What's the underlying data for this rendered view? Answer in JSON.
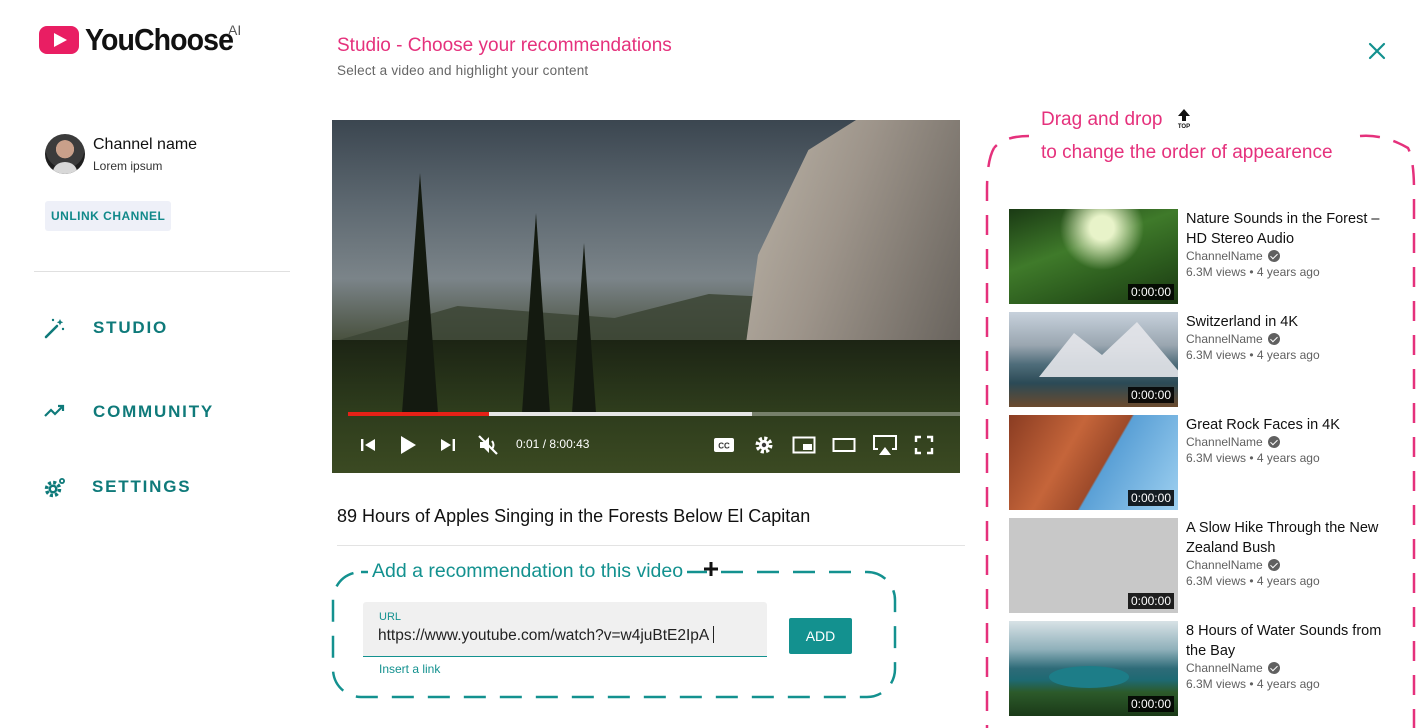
{
  "app": {
    "logo_text": "YouChoose",
    "logo_superscript": "AI"
  },
  "sidebar": {
    "channel_name": "Channel name",
    "channel_subtitle": "Lorem ipsum",
    "unlink_label": "UNLINK CHANNEL",
    "nav": [
      {
        "label": "STUDIO",
        "icon": "magic-wand-icon"
      },
      {
        "label": "COMMUNITY",
        "icon": "trending-icon"
      },
      {
        "label": "SETTINGS",
        "icon": "gear-icon"
      }
    ]
  },
  "header": {
    "title": "Studio - Choose your recommendations",
    "subtitle": "Select a video and highlight your content",
    "close_icon": "close-icon"
  },
  "player": {
    "current_time": "0:01",
    "separator": "/",
    "duration": "8:00:43",
    "played_fraction": 0.23,
    "buffered_fraction": 0.66
  },
  "video": {
    "title": "89 Hours of Apples Singing in the Forests Below El Capitan"
  },
  "add_recommendation": {
    "title": "Add a recommendation to this video",
    "url_label": "URL",
    "url_value": "https://www.youtube.com/watch?v=w4juBtE2IpA",
    "helper_text": "Insert a link",
    "add_label": "ADD"
  },
  "recommendations_panel": {
    "title": "Drag and drop",
    "subtitle": "to change the order of appearence",
    "items": [
      {
        "title": "Nature Sounds in the Forest – HD Stereo Audio",
        "channel": "ChannelName",
        "views": "6.3M views",
        "age": "4 years ago",
        "duration": "0:00:00"
      },
      {
        "title": "Switzerland in 4K",
        "channel": "ChannelName",
        "views": "6.3M views",
        "age": "4 years ago",
        "duration": "0:00:00"
      },
      {
        "title": "Great Rock Faces in 4K",
        "channel": "ChannelName",
        "views": "6.3M views",
        "age": "4 years ago",
        "duration": "0:00:00"
      },
      {
        "title": "A Slow Hike Through the New Zealand Bush",
        "channel": "ChannelName",
        "views": "6.3M views",
        "age": "4 years ago",
        "duration": "0:00:00"
      },
      {
        "title": "8 Hours of Water Sounds from the Bay",
        "channel": "ChannelName",
        "views": "6.3M views",
        "age": "4 years ago",
        "duration": "0:00:00"
      }
    ]
  },
  "colors": {
    "accent_pink": "#e5317c",
    "accent_teal": "#13918f",
    "progress_red": "#e62117"
  }
}
